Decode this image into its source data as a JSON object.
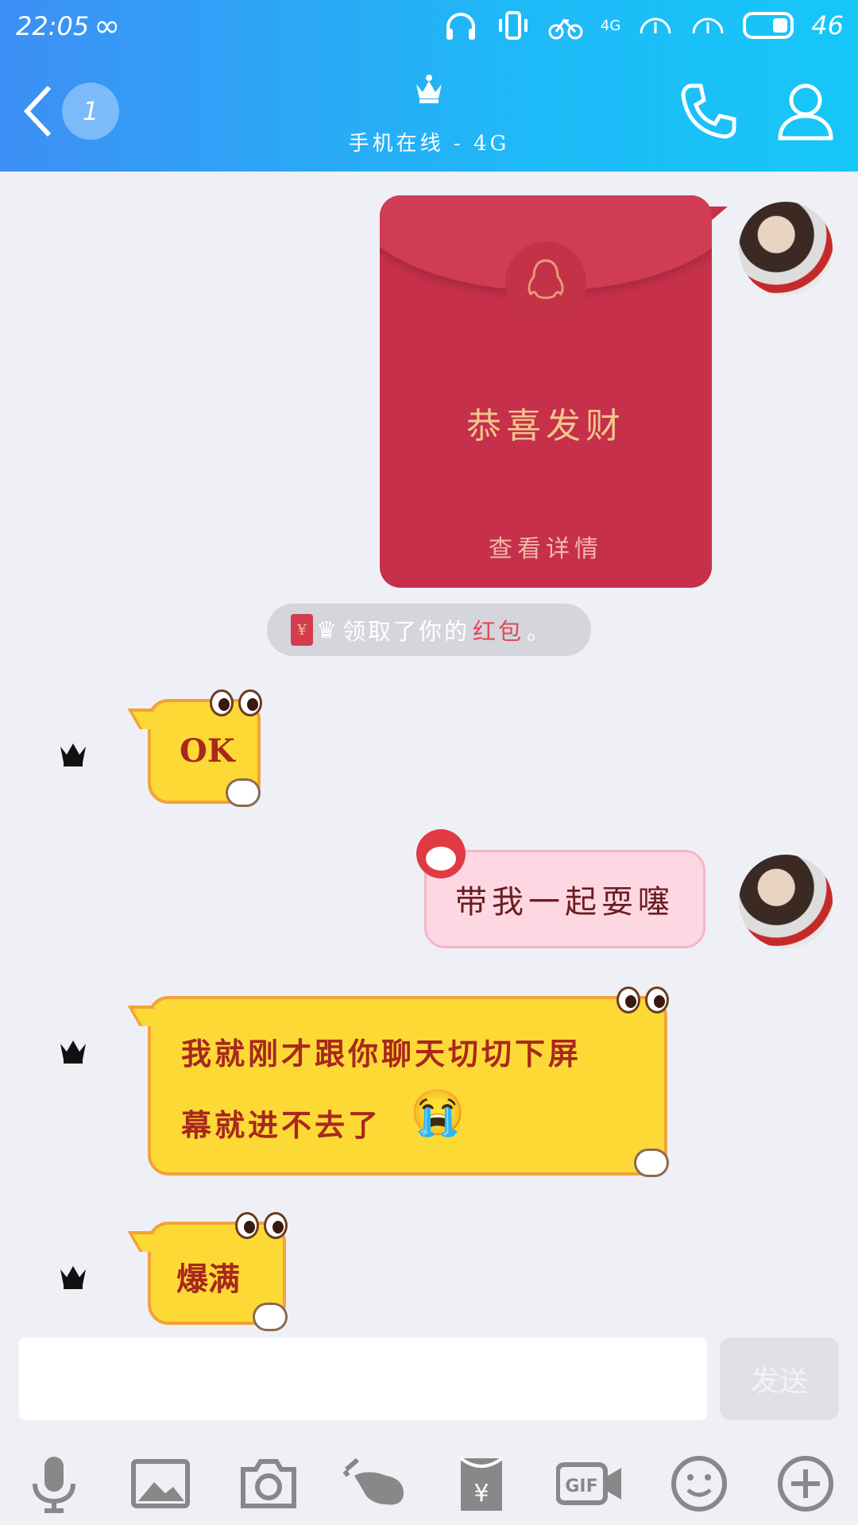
{
  "status_bar": {
    "time": "22:05",
    "loop_glyph": "∞",
    "network": "4G",
    "battery": "46"
  },
  "header": {
    "unread_count": "1",
    "subtitle": "手机在线 - 4G",
    "back_icon": "chevron-left-icon",
    "call_icon": "phone-icon",
    "profile_icon": "user-icon"
  },
  "messages": {
    "red_packet": {
      "greeting": "恭喜发财",
      "detail": "查看详情"
    },
    "system": {
      "rp_glyph": "¥",
      "crown": "♛",
      "text_before": "领取了你的",
      "text_highlight": "红包",
      "text_after": "。"
    },
    "ok_bubble": "OK",
    "pink_bubble": "带我一起耍噻",
    "long_bubble_line1": "我就刚才跟你聊天切切下屏",
    "long_bubble_line2": "幕就进不去了",
    "long_bubble_emoji": "😭",
    "last_bubble": "爆满"
  },
  "composer": {
    "input_value": "",
    "send_label": "发送"
  },
  "toolbar": {
    "items": [
      "microphone-icon",
      "image-icon",
      "camera-icon",
      "poke-icon",
      "red-packet-icon",
      "gif-icon",
      "emoji-icon",
      "plus-icon"
    ],
    "gif_label": "GIF",
    "yen_label": "¥"
  },
  "colors": {
    "header_start": "#3d8ff5",
    "header_end": "#16c7f9",
    "red_packet": "#c6304a",
    "bubble_yellow": "#fdd936",
    "bubble_pink": "#fdd7e2",
    "background": "#eef0f6"
  }
}
